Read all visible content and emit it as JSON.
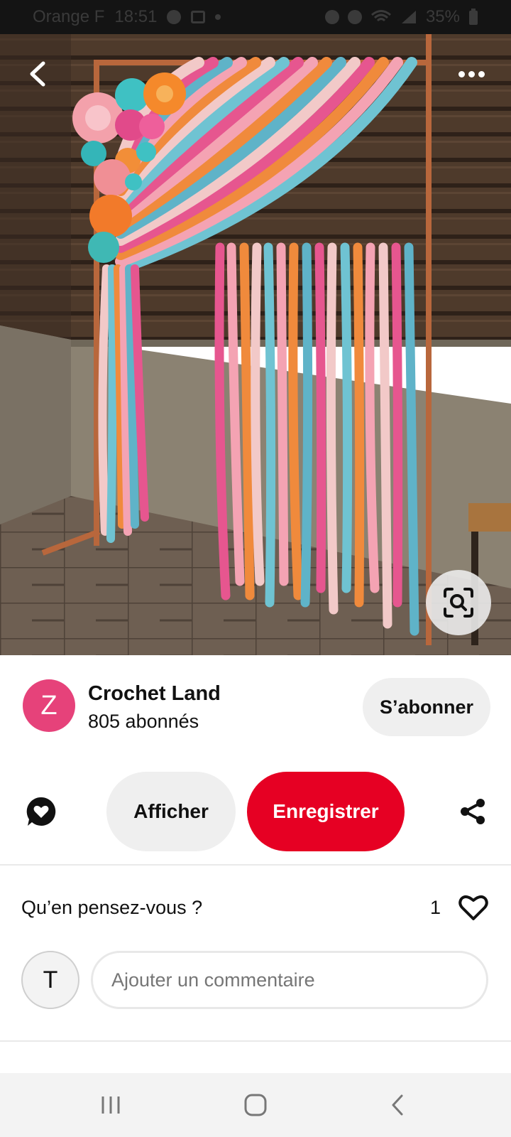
{
  "status_bar": {
    "carrier": "Orange F",
    "time": "18:51",
    "battery": "35%"
  },
  "creator": {
    "avatar_letter": "Z",
    "name": "Crochet Land",
    "followers": "805 abonnés",
    "follow_label": "S’abonner"
  },
  "actions": {
    "visit_label": "Afficher",
    "save_label": "Enregistrer"
  },
  "comments": {
    "title": "Qu’en pensez-vous ?",
    "like_count": "1",
    "user_initial": "T",
    "placeholder": "Ajouter un commentaire"
  },
  "colors": {
    "save_red": "#e60023",
    "avatar_pink": "#e6427a",
    "pill_gray": "#efefef"
  },
  "icons": [
    "chevron-left-icon",
    "more-dots-icon",
    "visual-search-icon",
    "comment-heart-icon",
    "share-icon",
    "heart-outline-icon",
    "recent-apps-icon",
    "home-icon",
    "back-icon"
  ]
}
